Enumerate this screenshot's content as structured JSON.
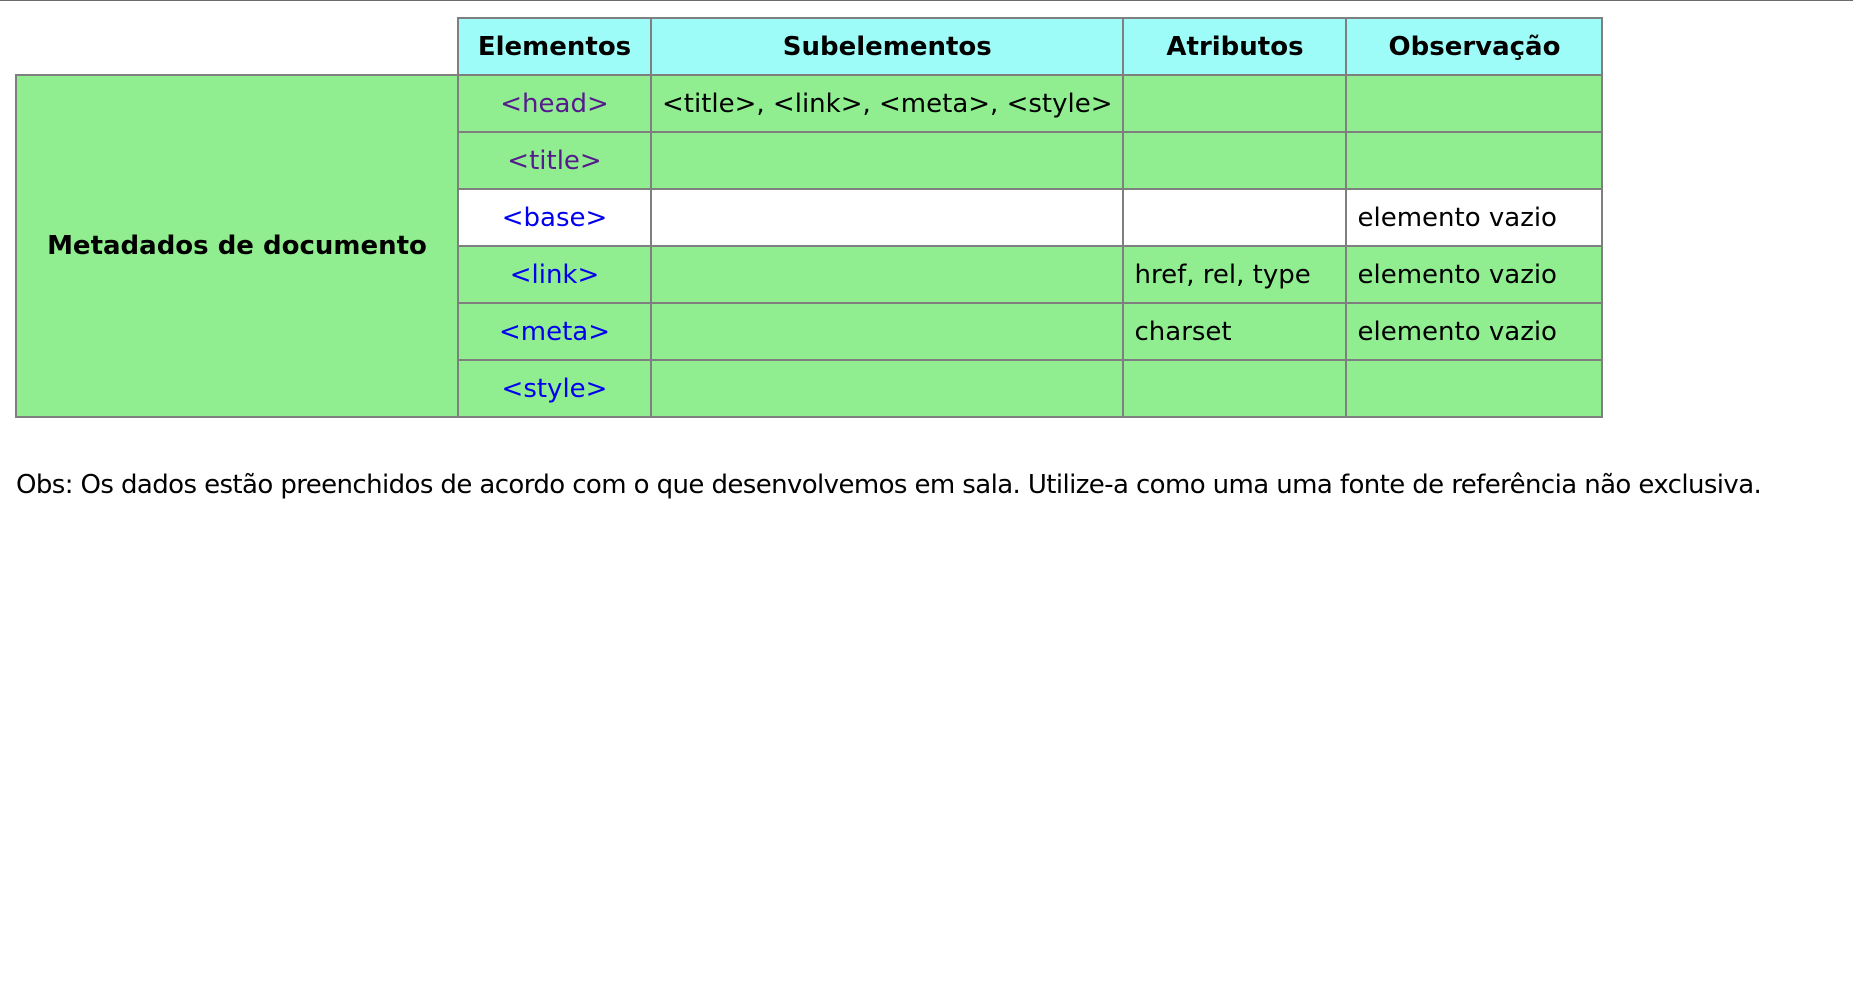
{
  "table": {
    "headers": {
      "elementos": "Elementos",
      "subelementos": "Subelementos",
      "atributos": "Atributos",
      "observacao": "Observação"
    },
    "group_label": "Metadados de documento",
    "rows": [
      {
        "element": "<head>",
        "subelements": "<title>, <link>, <meta>, <style>",
        "attributes": "",
        "observation": ""
      },
      {
        "element": "<title>",
        "subelements": "",
        "attributes": "",
        "observation": ""
      },
      {
        "element": "<base>",
        "subelements": "",
        "attributes": "",
        "observation": "elemento vazio"
      },
      {
        "element": "<link>",
        "subelements": "",
        "attributes": "href, rel, type",
        "observation": "elemento vazio"
      },
      {
        "element": "<meta>",
        "subelements": "",
        "attributes": "charset",
        "observation": "elemento vazio"
      },
      {
        "element": "<style>",
        "subelements": "",
        "attributes": "",
        "observation": ""
      }
    ]
  },
  "note": "Obs: Os dados estão preenchidos de acordo com o que desenvolvemos em sala. Utilize-a como uma uma fonte de referência não exclusiva.",
  "colors": {
    "header_bg": "#9efcf8",
    "row_green": "#90ee90",
    "row_white": "#ffffff",
    "link_visited": "#551a8b",
    "link_unvisited": "#0000ee",
    "border": "#7f7f7f"
  }
}
